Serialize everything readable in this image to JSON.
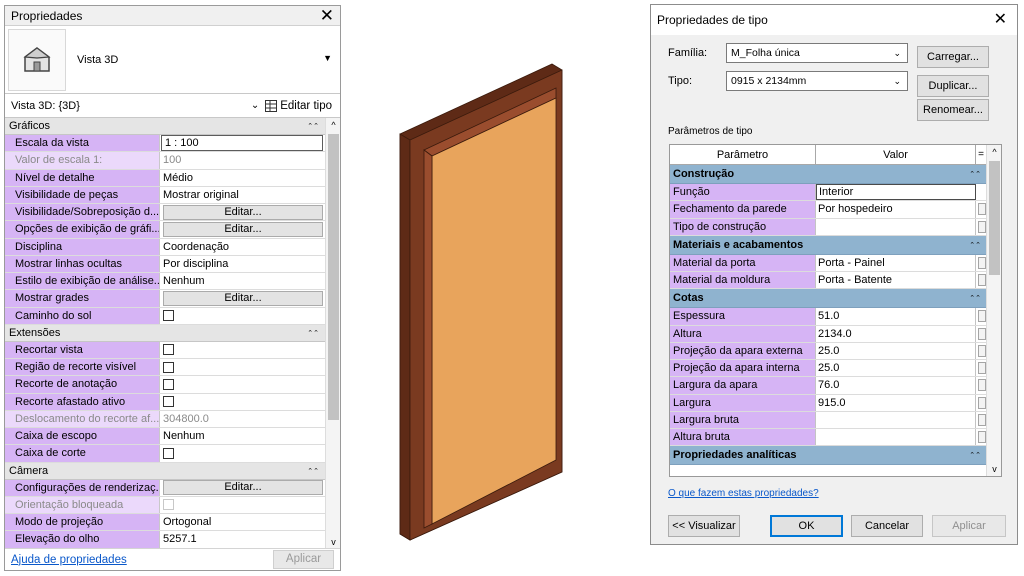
{
  "properties_panel": {
    "title": "Propriedades",
    "close_glyph": "✕",
    "type_name": "Vista 3D",
    "view_selector": "Vista 3D: {3D}",
    "edit_type_label": "Editar tipo",
    "help_link": "Ajuda de propriedades",
    "apply_label": "Aplicar",
    "groups": [
      {
        "name": "Gráficos",
        "rows": [
          {
            "name": "Escala da vista",
            "value": "1 : 100",
            "kind": "text",
            "boxed": true
          },
          {
            "name": "Valor de escala    1:",
            "value": "100",
            "kind": "text",
            "disabled": true
          },
          {
            "name": "Nível de detalhe",
            "value": "Médio",
            "kind": "text"
          },
          {
            "name": "Visibilidade de peças",
            "value": "Mostrar original",
            "kind": "text"
          },
          {
            "name": "Visibilidade/Sobreposição d...",
            "value": "Editar...",
            "kind": "button"
          },
          {
            "name": "Opções de exibição de gráfi...",
            "value": "Editar...",
            "kind": "button"
          },
          {
            "name": "Disciplina",
            "value": "Coordenação",
            "kind": "text"
          },
          {
            "name": "Mostrar linhas ocultas",
            "value": "Por disciplina",
            "kind": "text"
          },
          {
            "name": "Estilo de exibição de análise...",
            "value": "Nenhum",
            "kind": "text"
          },
          {
            "name": "Mostrar grades",
            "value": "Editar...",
            "kind": "button"
          },
          {
            "name": "Caminho do sol",
            "value": "",
            "kind": "checkbox"
          }
        ]
      },
      {
        "name": "Extensões",
        "rows": [
          {
            "name": "Recortar vista",
            "value": "",
            "kind": "checkbox"
          },
          {
            "name": "Região de recorte visível",
            "value": "",
            "kind": "checkbox"
          },
          {
            "name": "Recorte de anotação",
            "value": "",
            "kind": "checkbox"
          },
          {
            "name": "Recorte afastado ativo",
            "value": "",
            "kind": "checkbox"
          },
          {
            "name": "Deslocamento do recorte af...",
            "value": "304800.0",
            "kind": "text",
            "disabled": true
          },
          {
            "name": "Caixa de escopo",
            "value": "Nenhum",
            "kind": "text"
          },
          {
            "name": "Caixa de corte",
            "value": "",
            "kind": "checkbox"
          }
        ]
      },
      {
        "name": "Câmera",
        "rows": [
          {
            "name": "Configurações de renderizaç...",
            "value": "Editar...",
            "kind": "button"
          },
          {
            "name": "Orientação bloqueada",
            "value": "",
            "kind": "checkbox",
            "disabled": true
          },
          {
            "name": "Modo de projeção",
            "value": "Ortogonal",
            "kind": "text"
          },
          {
            "name": "Elevação do olho",
            "value": "5257.1",
            "kind": "text"
          }
        ]
      }
    ]
  },
  "type_dialog": {
    "title": "Propriedades de tipo",
    "close_glyph": "✕",
    "family_label": "Família:",
    "family_value": "M_Folha única",
    "type_label": "Tipo:",
    "type_value": "0915 x 2134mm",
    "load_button": "Carregar...",
    "duplicate_button": "Duplicar...",
    "rename_button": "Renomear...",
    "section_label": "Parâmetros de tipo",
    "col_param": "Parâmetro",
    "col_value": "Valor",
    "col_eq": "=",
    "groups": [
      {
        "name": "Construção",
        "rows": [
          {
            "name": "Função",
            "value": "Interior",
            "boxed": true
          },
          {
            "name": "Fechamento da parede",
            "value": "Por hospedeiro"
          },
          {
            "name": "Tipo de construção",
            "value": ""
          }
        ]
      },
      {
        "name": "Materiais e acabamentos",
        "rows": [
          {
            "name": "Material da porta",
            "value": "Porta - Painel"
          },
          {
            "name": "Material da moldura",
            "value": "Porta - Batente"
          }
        ]
      },
      {
        "name": "Cotas",
        "rows": [
          {
            "name": "Espessura",
            "value": "51.0"
          },
          {
            "name": "Altura",
            "value": "2134.0"
          },
          {
            "name": "Projeção da apara externa",
            "value": "25.0"
          },
          {
            "name": "Projeção da apara interna",
            "value": "25.0"
          },
          {
            "name": "Largura da apara",
            "value": "76.0"
          },
          {
            "name": "Largura",
            "value": "915.0"
          },
          {
            "name": "Largura bruta",
            "value": ""
          },
          {
            "name": "Altura bruta",
            "value": ""
          }
        ]
      },
      {
        "name": "Propriedades analíticas",
        "rows": []
      }
    ],
    "help_link": "O que fazem estas propriedades?",
    "preview_button": "<< Visualizar",
    "ok_button": "OK",
    "cancel_button": "Cancelar",
    "apply_button": "Aplicar"
  },
  "door_colors": {
    "panel": "#e8a45c",
    "frame": "#7a3a20",
    "frame_dark": "#5e2a16",
    "frame_light": "#9a4d2e"
  },
  "icons": {
    "house": "house-3d-icon",
    "edit_type": "edit-type-icon",
    "chevron_up": "▲",
    "chevron_down": "▼",
    "collapse": "⌃"
  }
}
